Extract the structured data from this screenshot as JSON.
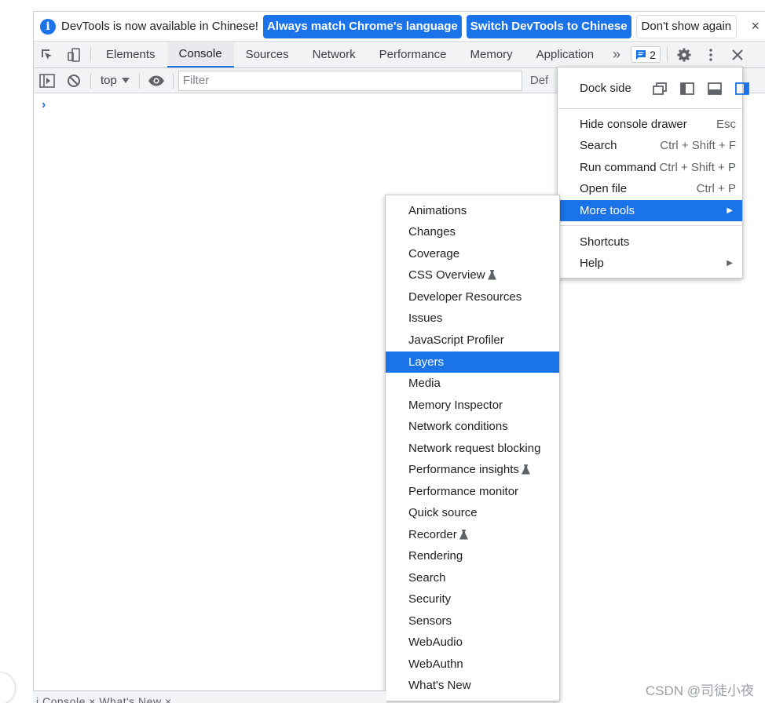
{
  "infobar": {
    "message": "DevTools is now available in Chinese!",
    "btn_match": "Always match Chrome's language",
    "btn_switch": "Switch DevTools to Chinese",
    "btn_dismiss": "Don't show again",
    "close": "×"
  },
  "tabs": [
    "Elements",
    "Console",
    "Sources",
    "Network",
    "Performance",
    "Memory",
    "Application"
  ],
  "active_tab": "Console",
  "issues_count": "2",
  "console_toolbar": {
    "context": "top",
    "filter_placeholder": "Filter",
    "levels_label": "Def"
  },
  "prompt_symbol": "›",
  "main_menu": {
    "dock_label": "Dock side",
    "items": [
      {
        "label": "Hide console drawer",
        "shortcut": "Esc"
      },
      {
        "label": "Search",
        "shortcut": "Ctrl + Shift + F"
      },
      {
        "label": "Run command",
        "shortcut": "Ctrl + Shift + P"
      },
      {
        "label": "Open file",
        "shortcut": "Ctrl + P"
      },
      {
        "label": "More tools",
        "shortcut": ""
      },
      {
        "label": "Shortcuts",
        "shortcut": ""
      },
      {
        "label": "Help",
        "shortcut": ""
      }
    ]
  },
  "more_tools": [
    "Animations",
    "Changes",
    "Coverage",
    "CSS Overview",
    "Developer Resources",
    "Issues",
    "JavaScript Profiler",
    "Layers",
    "Media",
    "Memory Inspector",
    "Network conditions",
    "Network request blocking",
    "Performance insights",
    "Performance monitor",
    "Quick source",
    "Recorder",
    "Rendering",
    "Search",
    "Security",
    "Sensors",
    "WebAudio",
    "WebAuthn",
    "What's New"
  ],
  "drawer_text": "i   Console   ×   What's New ×",
  "watermark": "CSDN @司徒小夜",
  "colors": {
    "accent": "#1a73e8"
  }
}
